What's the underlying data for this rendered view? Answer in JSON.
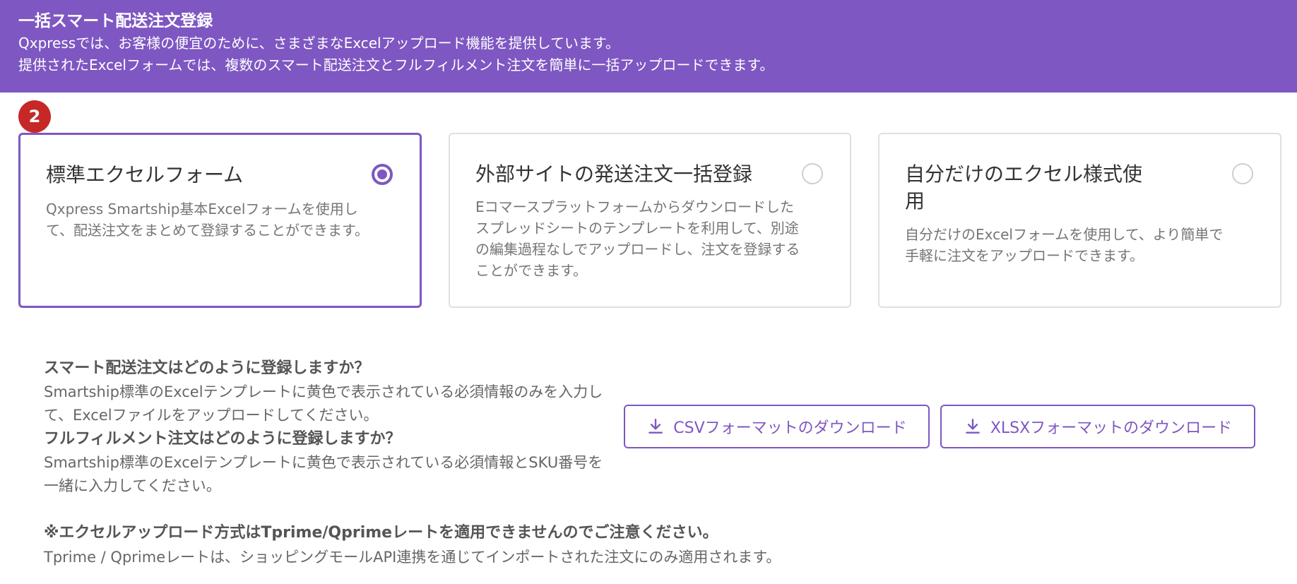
{
  "banner": {
    "title": "一括スマート配送注文登録",
    "line1": "Qxpressでは、お客様の便宜のために、さまざまなExcelアップロード機能を提供しています。",
    "line2": "提供されたExcelフォームでは、複数のスマート配送注文とフルフィルメント注文を簡単に一括アップロードできます。"
  },
  "step_badge": "2",
  "cards": [
    {
      "title": "標準エクセルフォーム",
      "desc": "Qxpress Smartship基本Excelフォームを使用して、配送注文をまとめて登録することができます。",
      "selected": true
    },
    {
      "title": "外部サイトの発送注文一括登録",
      "desc": "Eコマースプラットフォームからダウンロードしたスプレッドシートのテンプレートを利用して、別途の編集過程なしでアップロードし、注文を登録することができます。",
      "selected": false
    },
    {
      "title": "自分だけのエクセル様式使用",
      "desc": "自分だけのExcelフォームを使用して、より簡単で手軽に注文をアップロードできます。",
      "selected": false
    }
  ],
  "info": {
    "smart_heading": "スマート配送注文はどのように登録しますか？",
    "smart_text": "Smartship標準のExcelテンプレートに黄色で表示されている必須情報のみを入力して、Excelファイルをアップロードしてください。",
    "fulfill_heading": "フルフィルメント注文はどのように登録しますか？",
    "fulfill_text": "Smartship標準のExcelテンプレートに黄色で表示されている必須情報とSKU番号を一緒に入力してください。"
  },
  "buttons": {
    "csv_label": "CSVフォーマットのダウンロード",
    "xlsx_label": "XLSXフォーマットのダウンロード"
  },
  "note": {
    "heading": "※エクセルアップロード方式はTprime/Qprimeレートを適用できませんのでご注意ください。",
    "text": "Tprime / Qprimeレートは、ショッピングモールAPI連携を通じてインポートされた注文にのみ適用されます。"
  },
  "colors": {
    "accent": "#7e57c2",
    "badge": "#c62828"
  }
}
